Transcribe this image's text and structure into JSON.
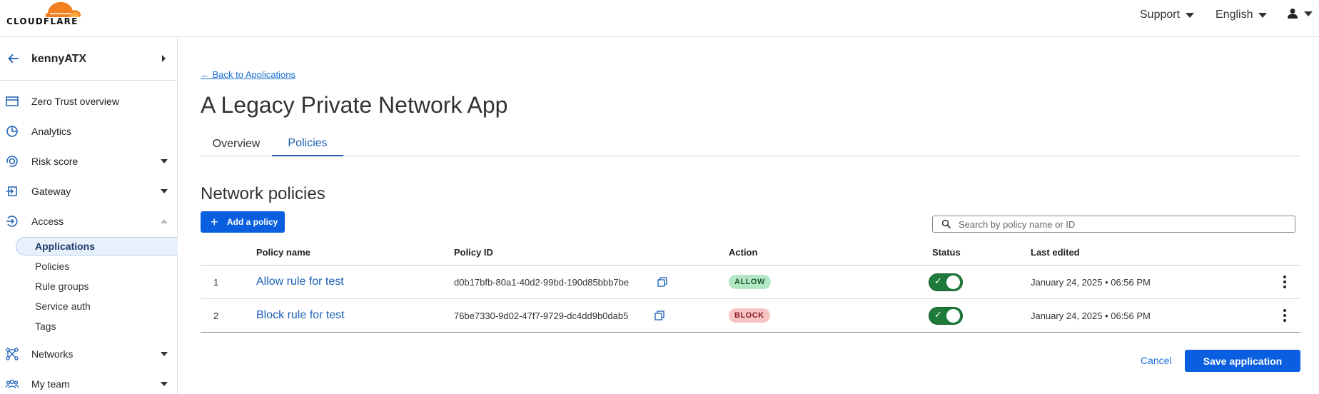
{
  "header": {
    "logo_text": "CLOUDFLARE",
    "support_label": "Support",
    "language_label": "English"
  },
  "sidebar": {
    "account_name": "kennyATX",
    "items": [
      {
        "label": "Zero Trust overview",
        "icon": "browser-window-icon"
      },
      {
        "label": "Analytics",
        "icon": "pie-chart-icon"
      },
      {
        "label": "Risk score",
        "icon": "risk-gauge-icon"
      },
      {
        "label": "Gateway",
        "icon": "gateway-icon"
      },
      {
        "label": "Access",
        "icon": "access-icon"
      },
      {
        "label": "Networks",
        "icon": "network-icon"
      },
      {
        "label": "My team",
        "icon": "team-icon"
      }
    ],
    "access_sub_items": [
      "Applications",
      "Policies",
      "Rule groups",
      "Service auth",
      "Tags"
    ]
  },
  "main": {
    "back_link": "← Back to Applications",
    "title": "A Legacy Private Network App",
    "tabs": [
      "Overview",
      "Policies"
    ],
    "active_tab": "Policies",
    "section_title": "Network policies",
    "add_button": "Add a policy",
    "search_placeholder": "Search by policy name or ID",
    "table": {
      "headers": [
        "Policy name",
        "Policy ID",
        "Action",
        "Status",
        "Last edited"
      ],
      "rows": [
        {
          "index": "1",
          "name": "Allow rule for test",
          "id": "d0b17bfb-80a1-40d2-99bd-190d85bbb7be",
          "action": "ALLOW",
          "status_on": true,
          "last_edited": "January 24, 2025 • 06:56 PM"
        },
        {
          "index": "2",
          "name": "Block rule for test",
          "id": "76be7330-9d02-47f7-9729-dc4dd9b0dab5",
          "action": "BLOCK",
          "status_on": true,
          "last_edited": "January 24, 2025 • 06:56 PM"
        }
      ]
    },
    "cancel_label": "Cancel",
    "save_label": "Save application"
  },
  "colors": {
    "accent": "#0a5fe0",
    "link": "#1a6fd6",
    "allow_bg": "#b4e6c4",
    "block_bg": "#f7c3c3",
    "toggle_on": "#1d7a3b",
    "logo_orange": "#f38020"
  }
}
